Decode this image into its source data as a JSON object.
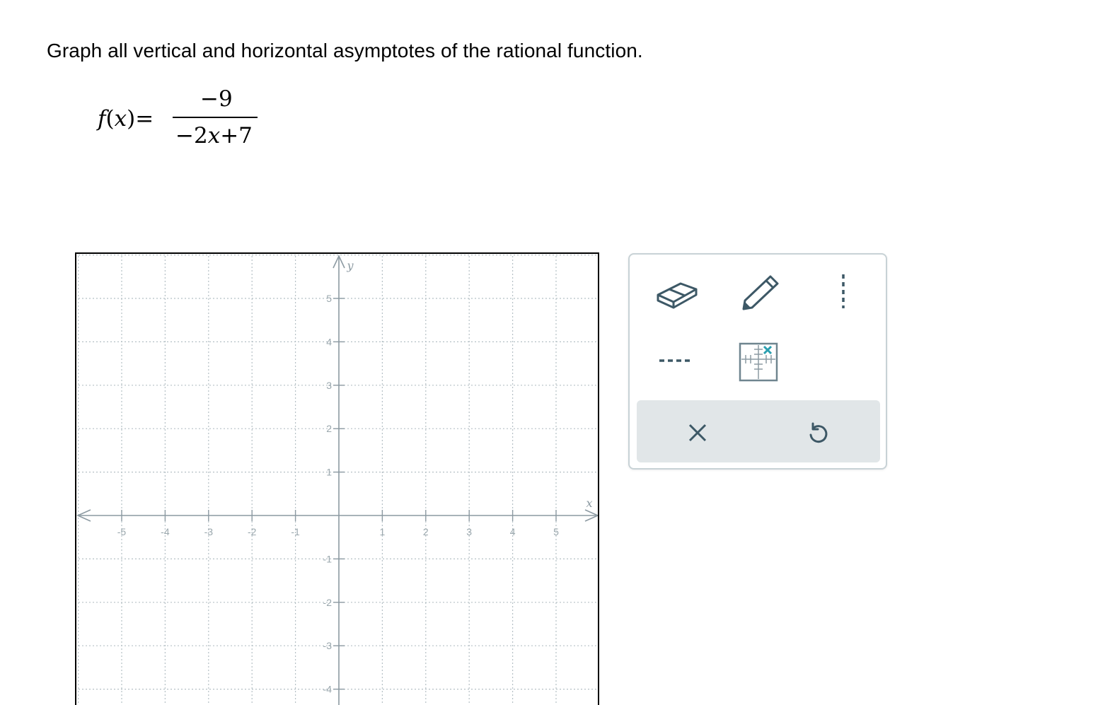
{
  "prompt": "Graph all vertical and horizontal asymptotes of the rational function.",
  "function": {
    "name": "f",
    "variable": "x",
    "numerator": "−9",
    "denominator_parts": [
      "−2",
      "x",
      "+7"
    ]
  },
  "graph": {
    "x_axis_label": "x",
    "y_axis_label": "y",
    "x_ticks": [
      "-5",
      "-4",
      "-3",
      "-2",
      "-1",
      "1",
      "2",
      "3",
      "4",
      "5"
    ],
    "y_ticks": [
      "5",
      "4",
      "3",
      "2",
      "1",
      "-1",
      "-2",
      "-3",
      "-4"
    ],
    "grid_style": "dotted",
    "axis_color": "#8c9aa2",
    "grid_color": "#b5c0c5"
  },
  "toolbox": {
    "tools": [
      "eraser-icon",
      "pencil-icon",
      "vertical-dashed-line-icon",
      "horizontal-dashed-line-icon",
      "graph-reset-icon"
    ],
    "actions": [
      "close-icon",
      "undo-icon"
    ],
    "icon_color": "#3d5866",
    "accent_color": "#2a9fb0",
    "border_color": "#c8d2d6",
    "action_bar_color": "#e1e6e8"
  }
}
